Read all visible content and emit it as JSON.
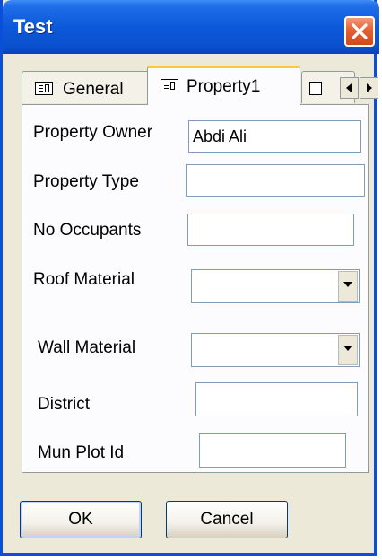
{
  "window": {
    "title": "Test"
  },
  "icons": {
    "close": "close-icon",
    "tab": "form-icon",
    "scroll_left": "arrow-left-icon",
    "scroll_right": "arrow-right-icon",
    "dropdown": "chevron-down-icon"
  },
  "colors": {
    "titlebar": "#0a50cd",
    "close_button": "#e5612f",
    "active_tab_highlight": "#ffc83c",
    "dialog_background": "#ece9d8"
  },
  "tabs": [
    {
      "label": "General",
      "active": false
    },
    {
      "label": "Property1",
      "active": true
    }
  ],
  "form": {
    "property_owner": {
      "label": "Property Owner",
      "value": "Abdi Ali"
    },
    "property_type": {
      "label": "Property Type",
      "value": ""
    },
    "no_occupants": {
      "label": "No Occupants",
      "value": ""
    },
    "roof_material": {
      "label": "Roof Material",
      "value": ""
    },
    "wall_material": {
      "label": "Wall Material",
      "value": ""
    },
    "district": {
      "label": "District",
      "value": ""
    },
    "mun_plot_id": {
      "label": "Mun Plot Id",
      "value": ""
    }
  },
  "buttons": {
    "ok": "OK",
    "cancel": "Cancel"
  }
}
